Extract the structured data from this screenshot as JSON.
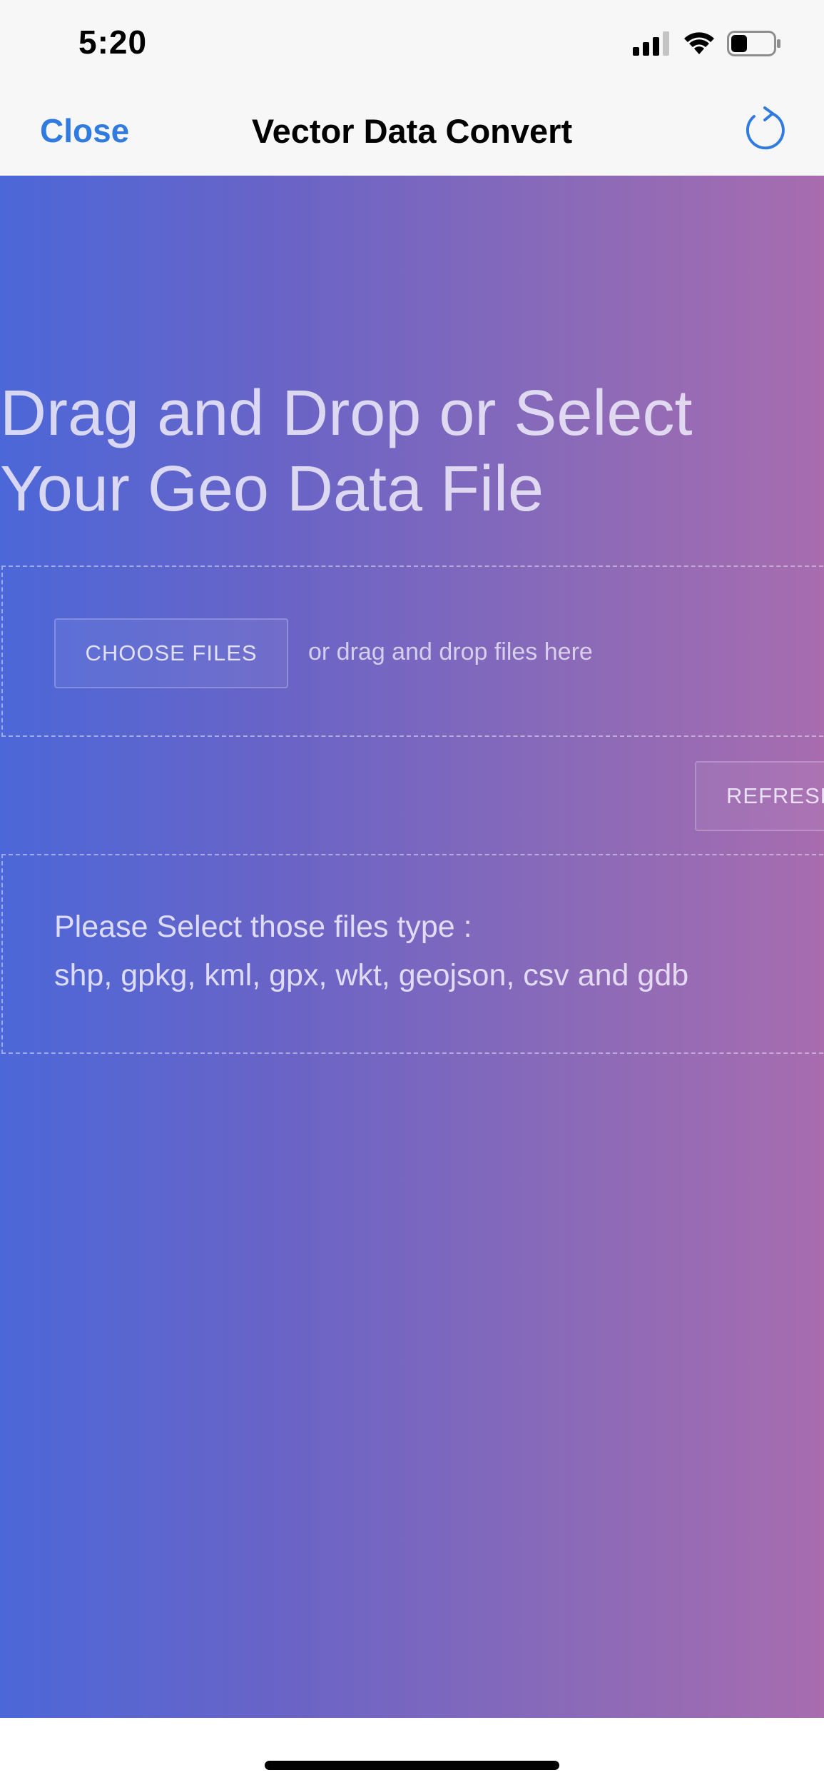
{
  "status_bar": {
    "time": "5:20",
    "icons": [
      "cellular-signal-icon",
      "wifi-icon",
      "battery-icon"
    ]
  },
  "nav": {
    "close_label": "Close",
    "title": "Vector Data Convert",
    "refresh_icon": "refresh-icon"
  },
  "main": {
    "headline": "Drag and Drop or Select Your Geo Data File",
    "choose_files_label": "CHOOSE FILES",
    "drop_hint": "or drag and drop files here",
    "refresh_label": "REFRESH",
    "info_line1": "Please Select those files type :",
    "info_line2": "shp, gpkg, kml, gpx, wkt, geojson, csv and gdb"
  },
  "colors": {
    "accent": "#2f7be0",
    "gradient_start": "#4c67d8",
    "gradient_end": "#a86caf"
  }
}
